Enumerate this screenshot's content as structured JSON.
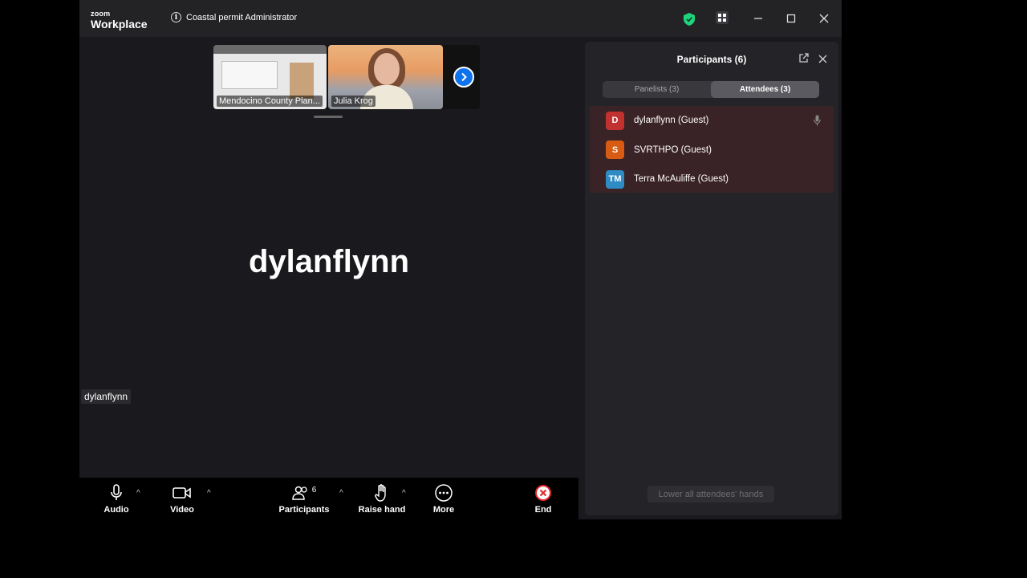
{
  "app": {
    "logo_top": "zoom",
    "logo_bottom": "Workplace"
  },
  "header": {
    "meeting_title": "Coastal permit Administrator"
  },
  "colors": {
    "accent": "#0e72ed",
    "shield": "#1fd37c",
    "end": "#e02828"
  },
  "thumbnails": [
    {
      "label": "Mendocino County Plan..."
    },
    {
      "label": "Julia Krog"
    }
  ],
  "stage": {
    "speaker_name": "dylanflynn",
    "name_tag": "dylanflynn"
  },
  "controls": {
    "audio": "Audio",
    "video": "Video",
    "participants": "Participants",
    "participants_count": "6",
    "raise_hand": "Raise hand",
    "more": "More",
    "end": "End"
  },
  "panel": {
    "title": "Participants (6)",
    "tabs": [
      {
        "label": "Panelists (3)"
      },
      {
        "label": "Attendees (3)"
      }
    ],
    "attendees": [
      {
        "initials": "D",
        "name": "dylanflynn (Guest)",
        "color": "#c0312f"
      },
      {
        "initials": "S",
        "name": "SVRTHPO (Guest)",
        "color": "#d75b12"
      },
      {
        "initials": "TM",
        "name": "Terra McAuliffe (Guest)",
        "color": "#2f8bc4"
      }
    ],
    "lower_hands": "Lower all attendees' hands"
  }
}
